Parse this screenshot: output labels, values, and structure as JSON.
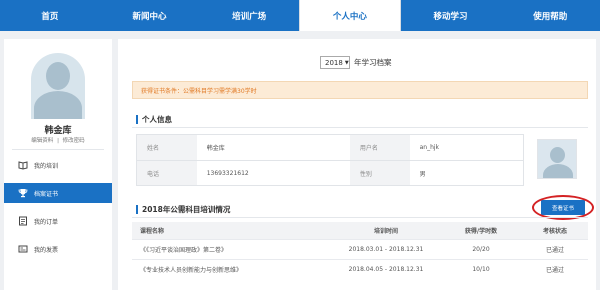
{
  "nav": {
    "items": [
      {
        "label": "首页"
      },
      {
        "label": "新闻中心"
      },
      {
        "label": "培训广场"
      },
      {
        "label": "个人中心"
      },
      {
        "label": "移动学习"
      },
      {
        "label": "使用帮助"
      }
    ],
    "active_index": 3,
    "accent": "#1a71c4"
  },
  "sidebar": {
    "user_name": "韩金库",
    "edit_profile": "编辑资料",
    "separator": "|",
    "change_password": "修改密码",
    "menu": [
      {
        "label": "我的培训",
        "icon": "book-icon"
      },
      {
        "label": "档案证书",
        "icon": "trophy-icon"
      },
      {
        "label": "我的订单",
        "icon": "order-icon"
      },
      {
        "label": "我的发票",
        "icon": "invoice-icon"
      }
    ],
    "active_menu_index": 1
  },
  "archive": {
    "year": "2018",
    "year_suffix": "年学习档案"
  },
  "notice": {
    "text": "获得证书条件：公需科目学习需学满30学时",
    "color": "#e07a26"
  },
  "personal": {
    "heading": "个人信息",
    "name_label": "姓名",
    "name_value": "韩金库",
    "username_label": "用户名",
    "username_value": "an_hjk",
    "phone_label": "电话",
    "phone_value": "13693321612",
    "gender_label": "性别",
    "gender_value": "男"
  },
  "training": {
    "heading": "2018年公需科目培训情况",
    "cert_button": "查看证书",
    "highlight_color": "#d42224",
    "columns": [
      "课程名称",
      "培训时间",
      "获得/学时数",
      "考核状态"
    ],
    "rows": [
      {
        "course": "《《习近平谈治国理政》第二卷》",
        "period": "2018.03.01 - 2018.12.31",
        "hours": "20/20",
        "status": "已通过"
      },
      {
        "course": "《专业技术人员创新能力与创新思维》",
        "period": "2018.04.05 - 2018.12.31",
        "hours": "10/10",
        "status": "已通过"
      }
    ]
  }
}
